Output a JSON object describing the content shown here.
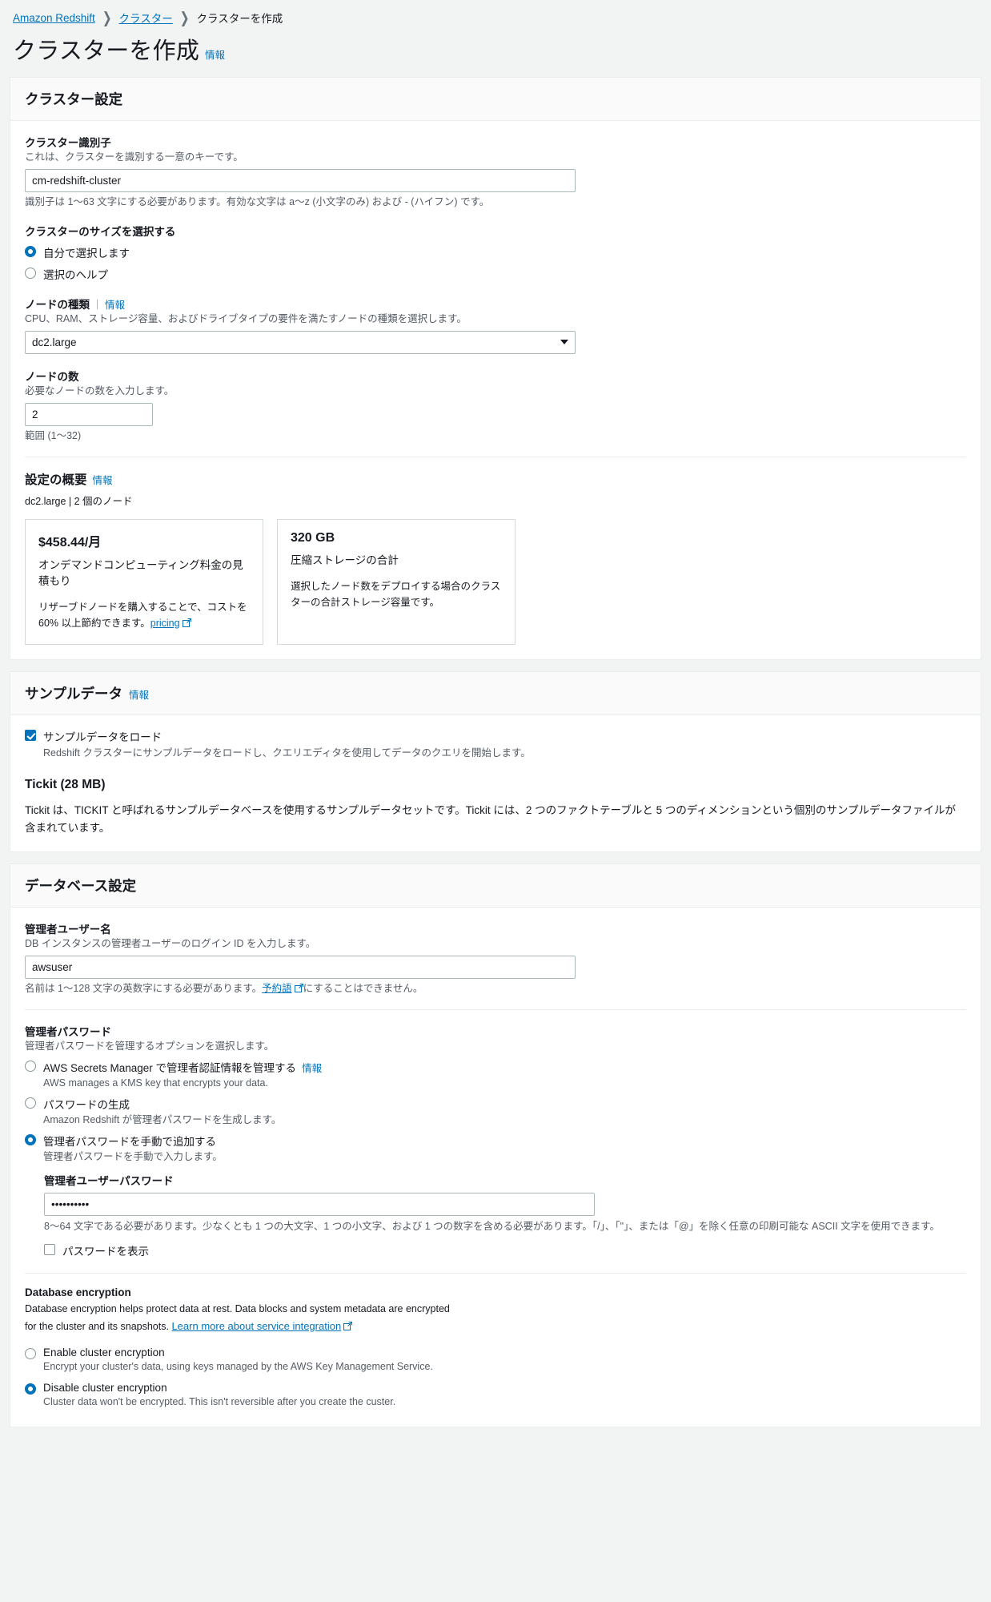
{
  "breadcrumb": {
    "items": [
      {
        "label": "Amazon Redshift",
        "link": true
      },
      {
        "label": "クラスター",
        "link": true
      },
      {
        "label": "クラスターを作成",
        "link": false
      }
    ],
    "separator": "❯"
  },
  "page": {
    "title": "クラスターを作成",
    "info_label": "情報"
  },
  "cluster_settings": {
    "panel_title": "クラスター設定",
    "identifier": {
      "label": "クラスター識別子",
      "desc": "これは、クラスターを識別する一意のキーです。",
      "value": "cm-redshift-cluster",
      "hint": "識別子は 1〜63 文字にする必要があります。有効な文字は a〜z (小文字のみ) および - (ハイフン) です。"
    },
    "size_choice": {
      "label": "クラスターのサイズを選択する",
      "options": [
        {
          "label": "自分で選択します",
          "selected": true
        },
        {
          "label": "選択のヘルプ",
          "selected": false
        }
      ]
    },
    "node_type": {
      "label": "ノードの種類",
      "info_label": "情報",
      "desc": "CPU、RAM、ストレージ容量、およびドライブタイプの要件を満たすノードの種類を選択します。",
      "value": "dc2.large"
    },
    "node_count": {
      "label": "ノードの数",
      "desc": "必要なノードの数を入力します。",
      "value": "2",
      "hint": "範囲 (1〜32)"
    },
    "summary": {
      "title": "設定の概要",
      "info_label": "情報",
      "subtitle": "dc2.large | 2 個のノード",
      "cards": [
        {
          "value": "$458.44/月",
          "label": "オンデマンドコンピューティング料金の見積もり",
          "note_before": "リザーブドノードを購入することで、コストを 60% 以上節約できます。",
          "note_link": "pricing",
          "note_after": ""
        },
        {
          "value": "320 GB",
          "label": "圧縮ストレージの合計",
          "note_before": "選択したノード数をデプロイする場合のクラスターの合計ストレージ容量です。",
          "note_link": "",
          "note_after": ""
        }
      ]
    }
  },
  "sample_data": {
    "panel_title": "サンプルデータ",
    "info_label": "情報",
    "checkbox": {
      "label": "サンプルデータをロード",
      "checked": true,
      "sub": "Redshift クラスターにサンプルデータをロードし、クエリエディタを使用してデータのクエリを開始します。"
    },
    "dataset_heading": "Tickit (28 MB)",
    "dataset_desc": "Tickit は、TICKIT と呼ばれるサンプルデータベースを使用するサンプルデータセットです。Tickit には、2 つのファクトテーブルと 5 つのディメンションという個別のサンプルデータファイルが含まれています。"
  },
  "database_settings": {
    "panel_title": "データベース設定",
    "admin_username": {
      "label": "管理者ユーザー名",
      "desc": "DB インスタンスの管理者ユーザーのログイン ID を入力します。",
      "value": "awsuser",
      "hint_before": "名前は 1〜128 文字の英数字にする必要があります。",
      "hint_link": "予約語",
      "hint_after": "にすることはできません。"
    },
    "admin_password": {
      "label": "管理者パスワード",
      "desc": "管理者パスワードを管理するオプションを選択します。",
      "options": [
        {
          "label": "AWS Secrets Manager で管理者認証情報を管理する",
          "info_label": "情報",
          "sub": "AWS manages a KMS key that encrypts your data.",
          "selected": false
        },
        {
          "label": "パスワードの生成",
          "info_label": "",
          "sub": "Amazon Redshift が管理者パスワードを生成します。",
          "selected": false
        },
        {
          "label": "管理者パスワードを手動で追加する",
          "info_label": "",
          "sub": "管理者パスワードを手動で入力します。",
          "selected": true
        }
      ],
      "password_field": {
        "label": "管理者ユーザーパスワード",
        "value": "••••••••••",
        "hint": "8〜64 文字である必要があります。少なくとも 1 つの大文字、1 つの小文字、および 1 つの数字を含める必要があります。「/」、「\"」、または「@」を除く任意の印刷可能な ASCII 文字を使用できます。"
      },
      "show_password": {
        "label": "パスワードを表示",
        "checked": false
      }
    },
    "encryption": {
      "title": "Database encryption",
      "desc_before": "Database encryption helps protect data at rest. Data blocks and system metadata are encrypted for the cluster and its snapshots.",
      "desc_link": "Learn more about service integration",
      "options": [
        {
          "label": "Enable cluster encryption",
          "sub": "Encrypt your cluster's data, using keys managed by the AWS Key Management Service.",
          "selected": false
        },
        {
          "label": "Disable cluster encryption",
          "sub": "Cluster data won't be encrypted. This isn't reversible after you create the custer.",
          "selected": true
        }
      ]
    }
  },
  "colors": {
    "link": "#0073bb",
    "text": "#16191f",
    "muted": "#545b64",
    "border": "#aab7b8",
    "panel_border": "#eaeded",
    "bg": "#f2f3f3"
  }
}
